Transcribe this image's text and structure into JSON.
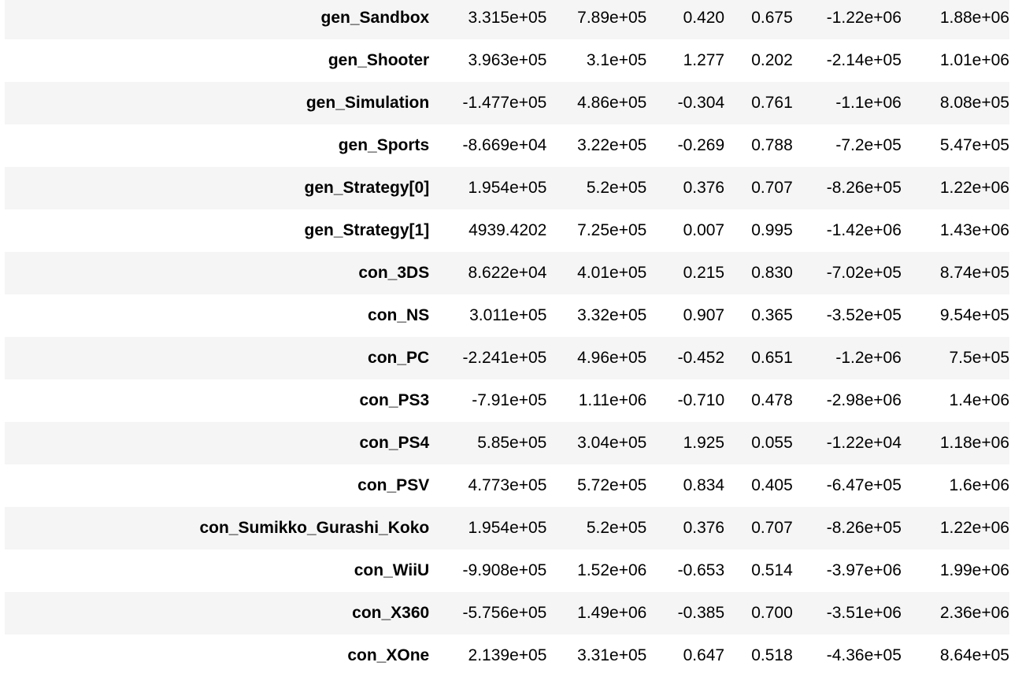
{
  "table": {
    "rows": [
      {
        "name": "gen_Sandbox",
        "cells": [
          "3.315e+05",
          "7.89e+05",
          "0.420",
          "0.675",
          "-1.22e+06",
          "1.88e+06"
        ]
      },
      {
        "name": "gen_Shooter",
        "cells": [
          "3.963e+05",
          "3.1e+05",
          "1.277",
          "0.202",
          "-2.14e+05",
          "1.01e+06"
        ]
      },
      {
        "name": "gen_Simulation",
        "cells": [
          "-1.477e+05",
          "4.86e+05",
          "-0.304",
          "0.761",
          "-1.1e+06",
          "8.08e+05"
        ]
      },
      {
        "name": "gen_Sports",
        "cells": [
          "-8.669e+04",
          "3.22e+05",
          "-0.269",
          "0.788",
          "-7.2e+05",
          "5.47e+05"
        ]
      },
      {
        "name": "gen_Strategy[0]",
        "cells": [
          "1.954e+05",
          "5.2e+05",
          "0.376",
          "0.707",
          "-8.26e+05",
          "1.22e+06"
        ]
      },
      {
        "name": "gen_Strategy[1]",
        "cells": [
          "4939.4202",
          "7.25e+05",
          "0.007",
          "0.995",
          "-1.42e+06",
          "1.43e+06"
        ]
      },
      {
        "name": "con_3DS",
        "cells": [
          "8.622e+04",
          "4.01e+05",
          "0.215",
          "0.830",
          "-7.02e+05",
          "8.74e+05"
        ]
      },
      {
        "name": "con_NS",
        "cells": [
          "3.011e+05",
          "3.32e+05",
          "0.907",
          "0.365",
          "-3.52e+05",
          "9.54e+05"
        ]
      },
      {
        "name": "con_PC",
        "cells": [
          "-2.241e+05",
          "4.96e+05",
          "-0.452",
          "0.651",
          "-1.2e+06",
          "7.5e+05"
        ]
      },
      {
        "name": "con_PS3",
        "cells": [
          "-7.91e+05",
          "1.11e+06",
          "-0.710",
          "0.478",
          "-2.98e+06",
          "1.4e+06"
        ]
      },
      {
        "name": "con_PS4",
        "cells": [
          "5.85e+05",
          "3.04e+05",
          "1.925",
          "0.055",
          "-1.22e+04",
          "1.18e+06"
        ]
      },
      {
        "name": "con_PSV",
        "cells": [
          "4.773e+05",
          "5.72e+05",
          "0.834",
          "0.405",
          "-6.47e+05",
          "1.6e+06"
        ]
      },
      {
        "name": "con_Sumikko_Gurashi_Koko",
        "cells": [
          "1.954e+05",
          "5.2e+05",
          "0.376",
          "0.707",
          "-8.26e+05",
          "1.22e+06"
        ]
      },
      {
        "name": "con_WiiU",
        "cells": [
          "-9.908e+05",
          "1.52e+06",
          "-0.653",
          "0.514",
          "-3.97e+06",
          "1.99e+06"
        ]
      },
      {
        "name": "con_X360",
        "cells": [
          "-5.756e+05",
          "1.49e+06",
          "-0.385",
          "0.700",
          "-3.51e+06",
          "2.36e+06"
        ]
      },
      {
        "name": "con_XOne",
        "cells": [
          "2.139e+05",
          "3.31e+05",
          "0.647",
          "0.518",
          "-4.36e+05",
          "8.64e+05"
        ]
      }
    ]
  },
  "colors": {
    "stripe": "#f5f5f5",
    "background": "#ffffff",
    "text": "#000000"
  }
}
